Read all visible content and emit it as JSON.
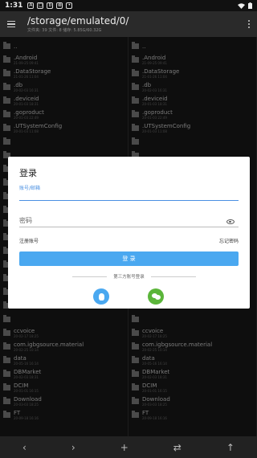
{
  "status": {
    "time": "1:31",
    "notifications": [
      "A",
      "▢",
      "b",
      "⊗",
      "•"
    ]
  },
  "appbar": {
    "path": "/storage/emulated/0/",
    "info": "文件夹: 39  文件: 8  储存: 5.85G/60.32G"
  },
  "left_pane": {
    "items": [
      {
        "name": "..",
        "date": ""
      },
      {
        "name": ".Android",
        "date": "21-09-25 09:41"
      },
      {
        "name": ".DataStorage",
        "date": "21-01-26 11:04"
      },
      {
        "name": ".db",
        "date": "20-02-03 16:31"
      },
      {
        "name": ".deviceid",
        "date": "20-01-03 18:31"
      },
      {
        "name": ".goproduct",
        "date": "20-01-03 22:49"
      },
      {
        "name": ".UTSystemConfig",
        "date": "20-01-03 11:08"
      },
      {
        "name": "",
        "date": ""
      },
      {
        "name": "",
        "date": ""
      },
      {
        "name": "",
        "date": ""
      },
      {
        "name": "",
        "date": ""
      },
      {
        "name": "",
        "date": ""
      },
      {
        "name": "",
        "date": ""
      },
      {
        "name": "",
        "date": ""
      },
      {
        "name": "",
        "date": ""
      },
      {
        "name": "",
        "date": ""
      },
      {
        "name": "",
        "date": ""
      },
      {
        "name": "",
        "date": ""
      },
      {
        "name": "",
        "date": ""
      },
      {
        "name": "",
        "date": ""
      },
      {
        "name": "",
        "date": ""
      },
      {
        "name": "ccvoice",
        "date": "20-02-17 18:25"
      },
      {
        "name": "com.igbgsource.material",
        "date": "20-02-25 10:14"
      },
      {
        "name": "data",
        "date": "20-05-16 16:14"
      },
      {
        "name": "DBMarket",
        "date": "20-02-03 18:31"
      },
      {
        "name": "DCIM",
        "date": "20-01-01 16:15"
      },
      {
        "name": "Download",
        "date": "20-03-03 18:25"
      },
      {
        "name": "FT",
        "date": "20-09-18 16:16"
      }
    ]
  },
  "right_pane": {
    "items": [
      {
        "name": "..",
        "date": ""
      },
      {
        "name": ".Android",
        "date": "21-09-25 09:41"
      },
      {
        "name": ".DataStorage",
        "date": "21-01-26 11:04"
      },
      {
        "name": ".db",
        "date": "20-02-03 16:31"
      },
      {
        "name": ".deviceid",
        "date": "20-01-03 18:31"
      },
      {
        "name": ".goproduct",
        "date": "20-01-03 22:49"
      },
      {
        "name": ".UTSystemConfig",
        "date": "20-01-03 11:08"
      },
      {
        "name": "",
        "date": ""
      },
      {
        "name": "",
        "date": ""
      },
      {
        "name": "",
        "date": ""
      },
      {
        "name": "",
        "date": ""
      },
      {
        "name": "",
        "date": ""
      },
      {
        "name": "",
        "date": ""
      },
      {
        "name": "",
        "date": ""
      },
      {
        "name": "",
        "date": ""
      },
      {
        "name": "",
        "date": ""
      },
      {
        "name": "",
        "date": ""
      },
      {
        "name": "",
        "date": ""
      },
      {
        "name": "",
        "date": ""
      },
      {
        "name": "",
        "date": ""
      },
      {
        "name": "",
        "date": ""
      },
      {
        "name": "ccvoice",
        "date": "20-02-17 18:25"
      },
      {
        "name": "com.igbgsource.material",
        "date": "20-02-25 10:14"
      },
      {
        "name": "data",
        "date": "20-05-16 16:14"
      },
      {
        "name": "DBMarket",
        "date": "20-02-03 18:31"
      },
      {
        "name": "DCIM",
        "date": "20-01-01 16:15"
      },
      {
        "name": "Download",
        "date": "20-03-03 18:25"
      },
      {
        "name": "FT",
        "date": "20-09-18 16:16"
      }
    ]
  },
  "bottombar": {
    "back": "‹",
    "forward": "›",
    "add": "+",
    "swap": "⇄",
    "up": "↑"
  },
  "login": {
    "title": "登录",
    "account_label": "账号/邮箱",
    "account_value": "",
    "password_placeholder": "密码",
    "register": "注册账号",
    "forgot": "忘记密码",
    "login_button": "登 录",
    "third_party": "第三方账号登录",
    "accent_color": "#4aa8f0",
    "wechat_color": "#5bb53a"
  }
}
